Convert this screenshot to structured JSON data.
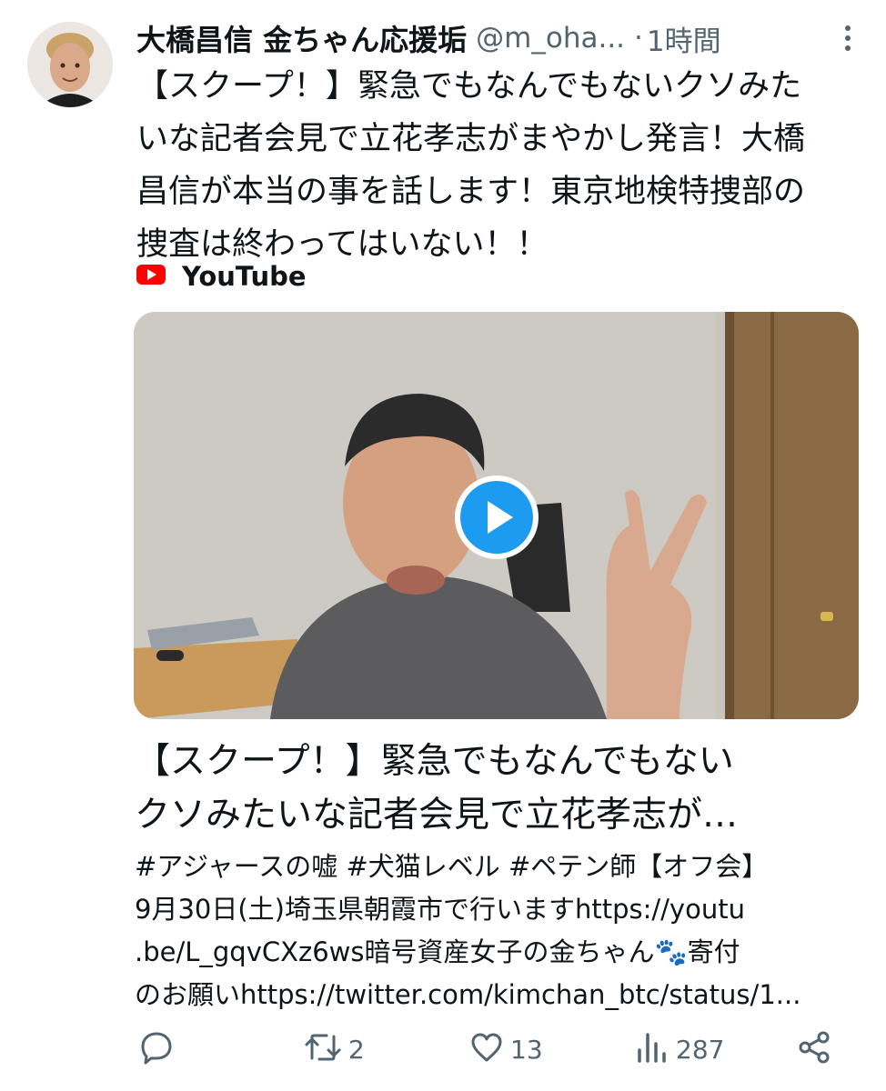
{
  "tweet": {
    "display_name": "大橋昌信 金ちゃん応援垢",
    "handle": "@m_oha...",
    "separator": "·",
    "time": "1時間",
    "text_lines": [
      "【スクープ！】緊急でもなんでもないクソみた",
      "いな記者会見で立花孝志がまやかし発言！大橋",
      "昌信が本当の事を話します！東京地検特捜部の",
      "捜査は終わってはいない！！"
    ]
  },
  "card": {
    "source": "YouTube",
    "title_lines": [
      "【スクープ！】緊急でもなんでもない",
      "クソみたいな記者会見で立花孝志が…"
    ],
    "description_lines": [
      "#アジャースの嘘 #犬猫レベル #ペテン師【オフ会】",
      "9月30日(土)埼玉県朝霞市で行いますhttps://youtu",
      ".be/L_gqvCXz6ws暗号資産女子の金ちゃん🐾寄付",
      "のお願いhttps://twitter.com/kimchan_btc/status/1..."
    ]
  },
  "actions": {
    "reply_count": "",
    "retweet_count": "2",
    "like_count": "13",
    "view_count": "287"
  },
  "icons": {
    "more": "more-icon",
    "reply": "reply-icon",
    "retweet": "retweet-icon",
    "like": "like-icon",
    "views": "views-icon",
    "share": "share-icon",
    "play": "play-icon",
    "youtube": "youtube-icon"
  },
  "colors": {
    "text": "#0f1419",
    "secondary": "#536471",
    "youtube_red": "#ff0000",
    "play_blue": "#1d9bf0"
  }
}
